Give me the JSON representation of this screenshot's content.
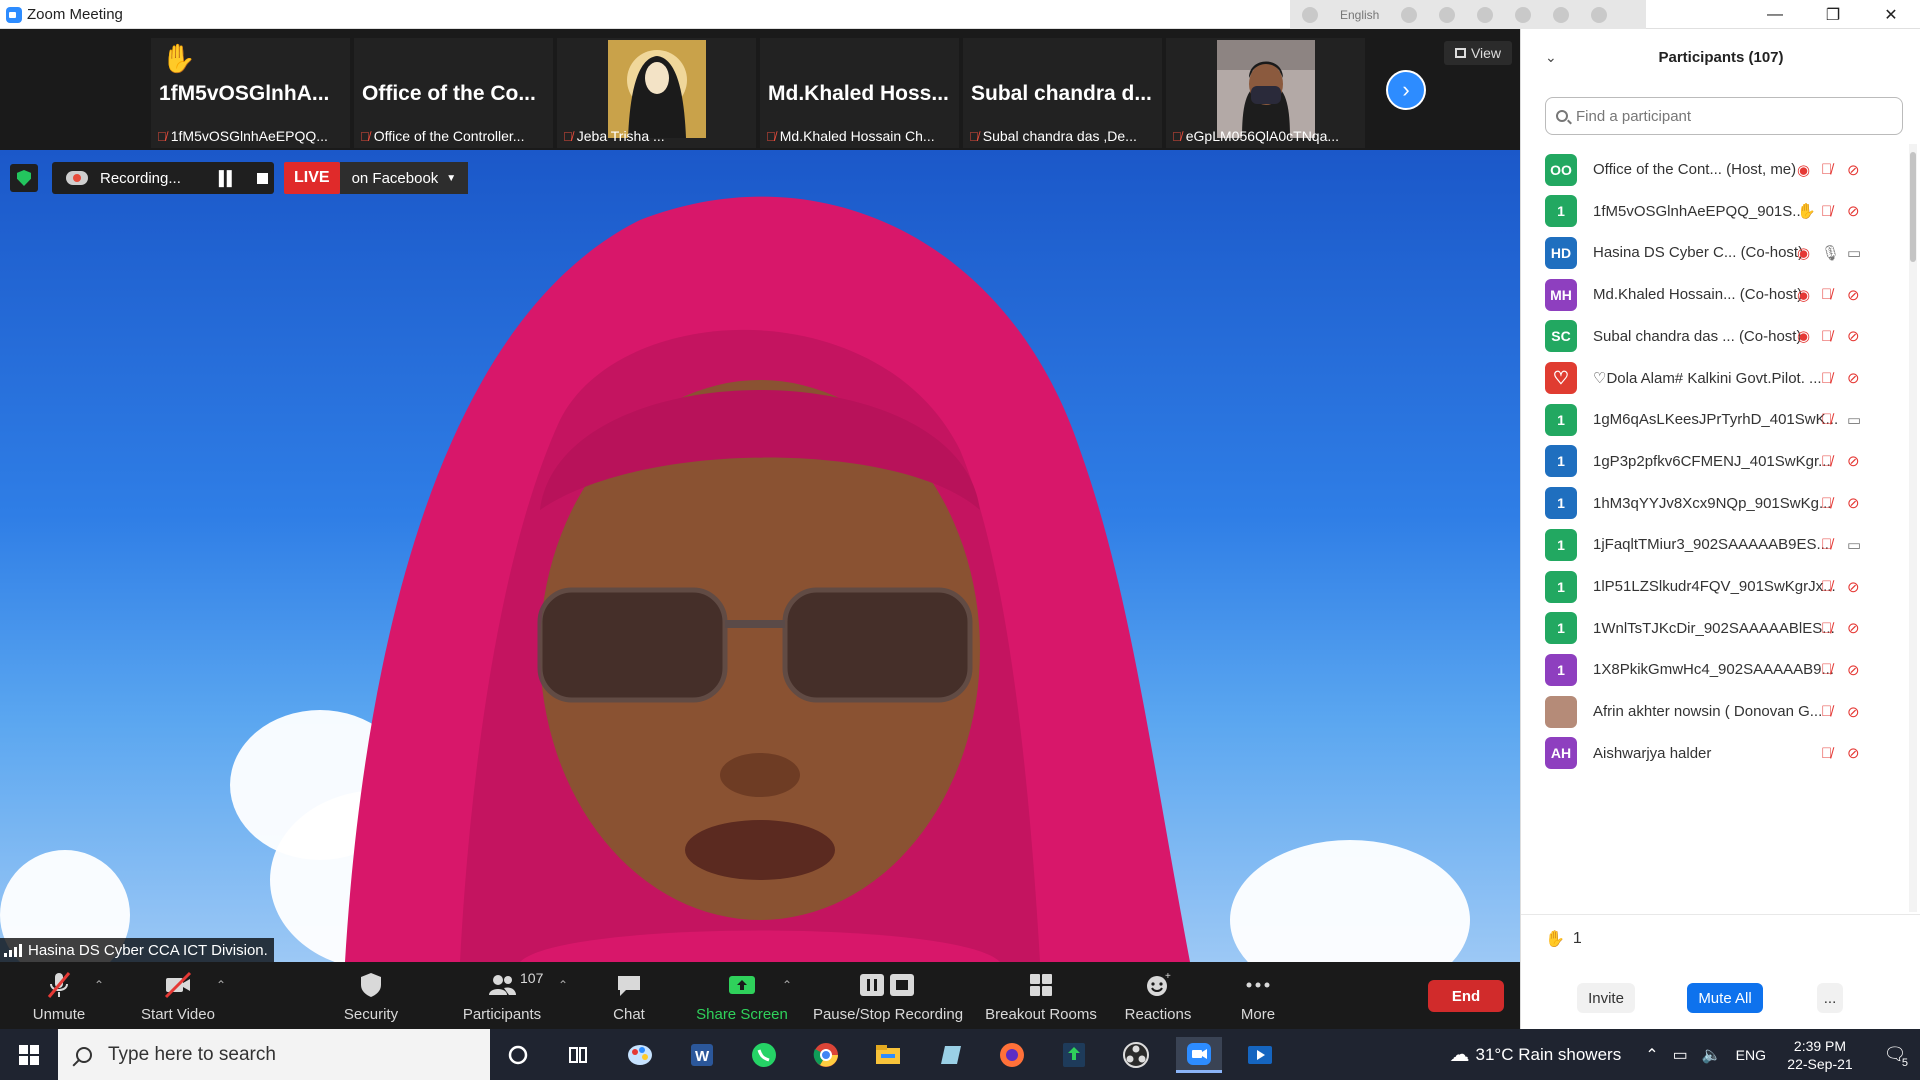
{
  "window": {
    "title": "Zoom Meeting",
    "lang_bar_text": "English",
    "controls": [
      "—",
      "❐",
      "✕"
    ]
  },
  "gallery": {
    "tiles": [
      {
        "big": "1fM5vOSGlnhA...",
        "label": "1fM5vOSGlnhAeEPQQ...",
        "hand": "✋",
        "type": "name"
      },
      {
        "big": "Office of the Co...",
        "label": "Office of the Controller...",
        "type": "name"
      },
      {
        "big": "",
        "label": "Jeba Trisha ...",
        "type": "photo-drawing"
      },
      {
        "big": "Md.Khaled Hoss...",
        "label": "Md.Khaled Hossain Ch...",
        "type": "name"
      },
      {
        "big": "Subal chandra d...",
        "label": "Subal chandra das ,De...",
        "type": "name"
      },
      {
        "big": "",
        "label": "eGpLM056QlA0cTNqa...",
        "type": "photo-mask"
      }
    ],
    "view_label": "View"
  },
  "video": {
    "recording_label": "Recording...",
    "live_label": "LIVE",
    "platform_label": "on Facebook",
    "speaker_name": "Hasina DS Cyber CCA ICT Division."
  },
  "toolbar": {
    "unmute": "Unmute",
    "start_video": "Start Video",
    "security": "Security",
    "participants": "Participants",
    "participant_count": "107",
    "chat": "Chat",
    "share_screen": "Share Screen",
    "pause_stop_recording": "Pause/Stop Recording",
    "breakout_rooms": "Breakout Rooms",
    "reactions": "Reactions",
    "more": "More",
    "end": "End"
  },
  "participants_panel": {
    "title": "Participants (107)",
    "search_placeholder": "Find a participant",
    "rows": [
      {
        "initials": "OO",
        "color": "#22a861",
        "name": "Office of the Cont...",
        "role": "(Host, me)",
        "rec": true,
        "mic": "off",
        "cam": "off"
      },
      {
        "initials": "1",
        "color": "#22a861",
        "name": "1fM5vOSGlnhAeEPQQ_901S...",
        "role": "",
        "hand": true,
        "mic": "off",
        "cam": "off"
      },
      {
        "initials": "HD",
        "color": "#1f6fbf",
        "name": "Hasina DS Cyber C...",
        "role": "(Co-host)",
        "rec": true,
        "mic": "on",
        "cam": "on"
      },
      {
        "initials": "MH",
        "color": "#8e3fbf",
        "name": "Md.Khaled Hossain...",
        "role": "(Co-host)",
        "rec": true,
        "mic": "off",
        "cam": "off"
      },
      {
        "initials": "SC",
        "color": "#22a861",
        "name": "Subal chandra das ...",
        "role": "(Co-host)",
        "rec": true,
        "mic": "off",
        "cam": "off"
      },
      {
        "initials": "♡",
        "color": "#e03c31",
        "name": "♡Dola Alam# Kalkini Govt.Pilot. ...",
        "role": "",
        "mic": "off",
        "cam": "off"
      },
      {
        "initials": "1",
        "color": "#22a861",
        "name": "1gM6qAsLKeesJPrTyrhD_401SwK...",
        "role": "",
        "mic": "off",
        "cam": "on"
      },
      {
        "initials": "1",
        "color": "#1f6fbf",
        "name": "1gP3p2pfkv6CFMENJ_401SwKgr...",
        "role": "",
        "mic": "off",
        "cam": "off"
      },
      {
        "initials": "1",
        "color": "#1f6fbf",
        "name": "1hM3qYYJv8Xcx9NQp_901SwKg...",
        "role": "",
        "mic": "off",
        "cam": "off"
      },
      {
        "initials": "1",
        "color": "#22a861",
        "name": "1jFaqltTMiur3_902SAAAAAB9ES...",
        "role": "",
        "mic": "off",
        "cam": "on"
      },
      {
        "initials": "1",
        "color": "#22a861",
        "name": "1lP51LZSlkudr4FQV_901SwKgrJx...",
        "role": "",
        "mic": "off",
        "cam": "off"
      },
      {
        "initials": "1",
        "color": "#22a861",
        "name": "1WnlTsTJKcDir_902SAAAAABlES...",
        "role": "",
        "mic": "off",
        "cam": "off"
      },
      {
        "initials": "1",
        "color": "#8e3fbf",
        "name": "1X8PkikGmwHc4_902SAAAAAB9...",
        "role": "",
        "mic": "off",
        "cam": "off"
      },
      {
        "initials": "",
        "color": "#b58b78",
        "name": "Afrin akhter nowsin ( Donovan G...",
        "role": "",
        "mic": "off",
        "cam": "off",
        "photo": true
      },
      {
        "initials": "AH",
        "color": "#8e3fbf",
        "name": "Aishwarjya halder",
        "role": "",
        "mic": "off",
        "cam": "off"
      }
    ],
    "raised_hands": "1",
    "invite": "Invite",
    "mute_all": "Mute All",
    "more": "..."
  },
  "taskbar": {
    "search_placeholder": "Type here to search",
    "weather": "31°C  Rain showers",
    "lang": "ENG",
    "time": "2:39 PM",
    "date": "22-Sep-21",
    "notification_count": "5"
  },
  "colors": {
    "zoom_blue": "#2d8cff",
    "live_red": "#e02a2a",
    "end_red": "#d12b2b",
    "share_green": "#2fd15b",
    "mute_all_blue": "#0e72ed"
  }
}
